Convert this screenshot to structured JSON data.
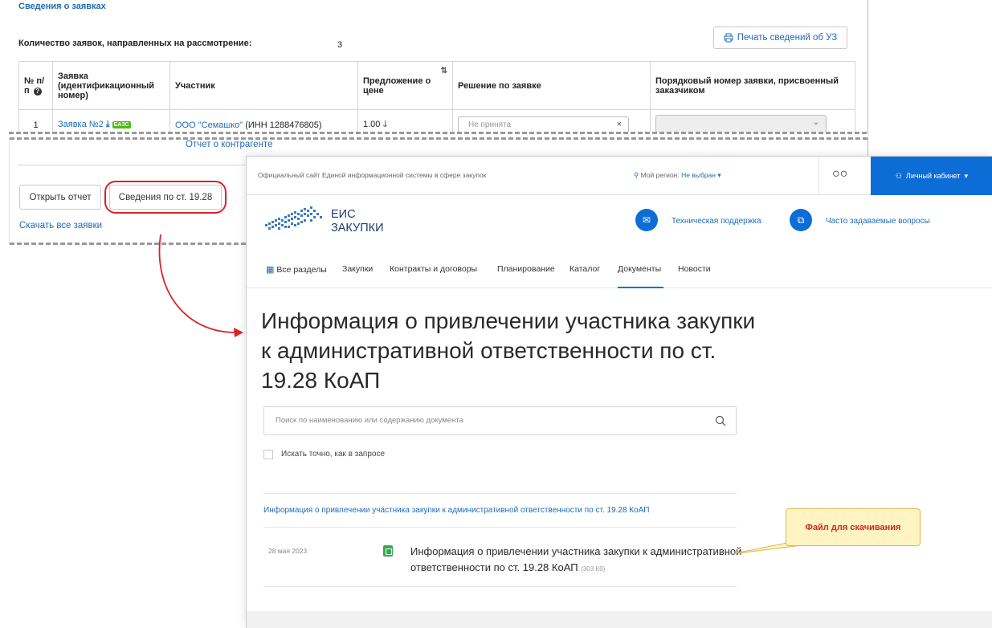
{
  "applications": {
    "section_title": "Сведения о заявках",
    "count_label": "Количество заявок, направленных на рассмотрение:",
    "count_value": "3",
    "print_button": "Печать сведений об УЗ",
    "columns": {
      "num": "№ п/п",
      "application": "Заявка (идентификационный номер)",
      "participant": "Участник",
      "price": "Предложение о цене",
      "decision": "Решение по заявке",
      "order_num": "Порядковый номер заявки, присвоенный заказчиком"
    },
    "rows": [
      {
        "num": "1",
        "application": "Заявка №2",
        "badge": "ЕАЗС",
        "participant_name": "ООО \"Семашко\"",
        "participant_inn": "(ИНН 1288476805)",
        "price": "1.00",
        "decision": "Не принята",
        "report_link": "Отчет о контрагенте"
      }
    ],
    "open_report_button": "Открыть отчет",
    "info_1928_button": "Сведения по ст. 19.28",
    "download_all_link": "Скачать все заявки"
  },
  "eis": {
    "official_site": "Официальный сайт Единой информационной системы в сфере закупок",
    "region_label": "Мой регион:",
    "region_value": "Не выбран",
    "cabinet_button": "Личный кабинет",
    "logo_line1": "ЕИС",
    "logo_line2": "ЗАКУПКИ",
    "support_link": "Техническая поддержка",
    "faq_link": "Часто задаваемые вопросы",
    "nav": [
      "Все разделы",
      "Закупки",
      "Контракты и договоры",
      "Планирование",
      "Каталог",
      "Документы",
      "Новости"
    ],
    "page_title": "Информация о привлечении участника закупки к административной ответственности по ст. 19.28 КоАП",
    "search_placeholder": "Поиск по наименованию или содержанию документа",
    "exact_search_label": "Искать точно, как в запросе",
    "category_link": "Информация о привлечении участника закупки к административной ответственности по ст. 19.28 КоАП",
    "doc_date": "28 мая 2023",
    "doc_title": "Информация о привлечении участника закупки к административной ответственности по ст. 19.28 КоАП",
    "doc_size": "(303 Кб)"
  },
  "callout": {
    "text": "Файл для скачивания"
  },
  "colors": {
    "link_blue": "#1f6bb8",
    "eis_blue": "#0d6dd6",
    "highlight_red": "#d9232a",
    "callout_bg": "#fff4c2",
    "badge_green": "#4cbb17"
  }
}
